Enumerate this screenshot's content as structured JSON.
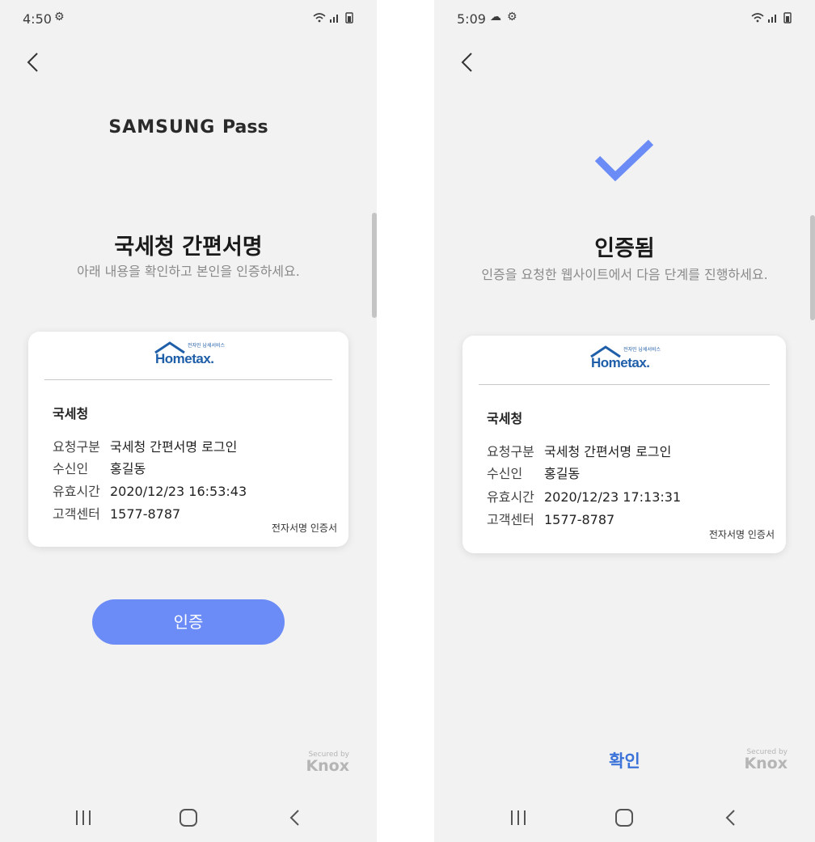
{
  "screens": [
    {
      "status": {
        "time": "4:50",
        "icons": [
          "gear-icon"
        ]
      },
      "brand": {
        "main": "SAMSUNG",
        "sub": "Pass"
      },
      "title": "국세청 간편서명",
      "subtitle": "아래 내용을 확인하고 본인을 인증하세요.",
      "card": {
        "logo_text": "Hometax.",
        "logo_small": "전자민 납세서비스",
        "org": "국세청",
        "rows": [
          {
            "label": "요청구분",
            "value": "국세청 간편서명 로그인"
          },
          {
            "label": "수신인",
            "value": "홍길동"
          },
          {
            "label": "유효시간",
            "value": "2020/12/23 16:53:43"
          },
          {
            "label": "고객센터",
            "value": "1577-8787"
          }
        ],
        "cert": "전자서명 인증서"
      },
      "button": "인증",
      "knox": {
        "secured": "Secured by",
        "name": "Knox"
      }
    },
    {
      "status": {
        "time": "5:09",
        "icons": [
          "cloud-icon",
          "gear-icon"
        ]
      },
      "title": "인증됨",
      "subtitle": "인증을 요청한 웹사이트에서 다음 단계를 진행하세요.",
      "card": {
        "logo_text": "Hometax.",
        "logo_small": "전자민 납세서비스",
        "org": "국세청",
        "rows": [
          {
            "label": "요청구분",
            "value": "국세청 간편서명 로그인"
          },
          {
            "label": "수신인",
            "value": "홍길동"
          },
          {
            "label": "유효시간",
            "value": "2020/12/23 17:13:31"
          },
          {
            "label": "고객센터",
            "value": "1577-8787"
          }
        ],
        "cert": "전자서명 인증서"
      },
      "button": "확인",
      "knox": {
        "secured": "Secured by",
        "name": "Knox"
      }
    }
  ],
  "colors": {
    "accent": "#6b8cf7",
    "confirm": "#3b73d9",
    "check": "#6b8cf7",
    "background": "#f2f2f2"
  }
}
